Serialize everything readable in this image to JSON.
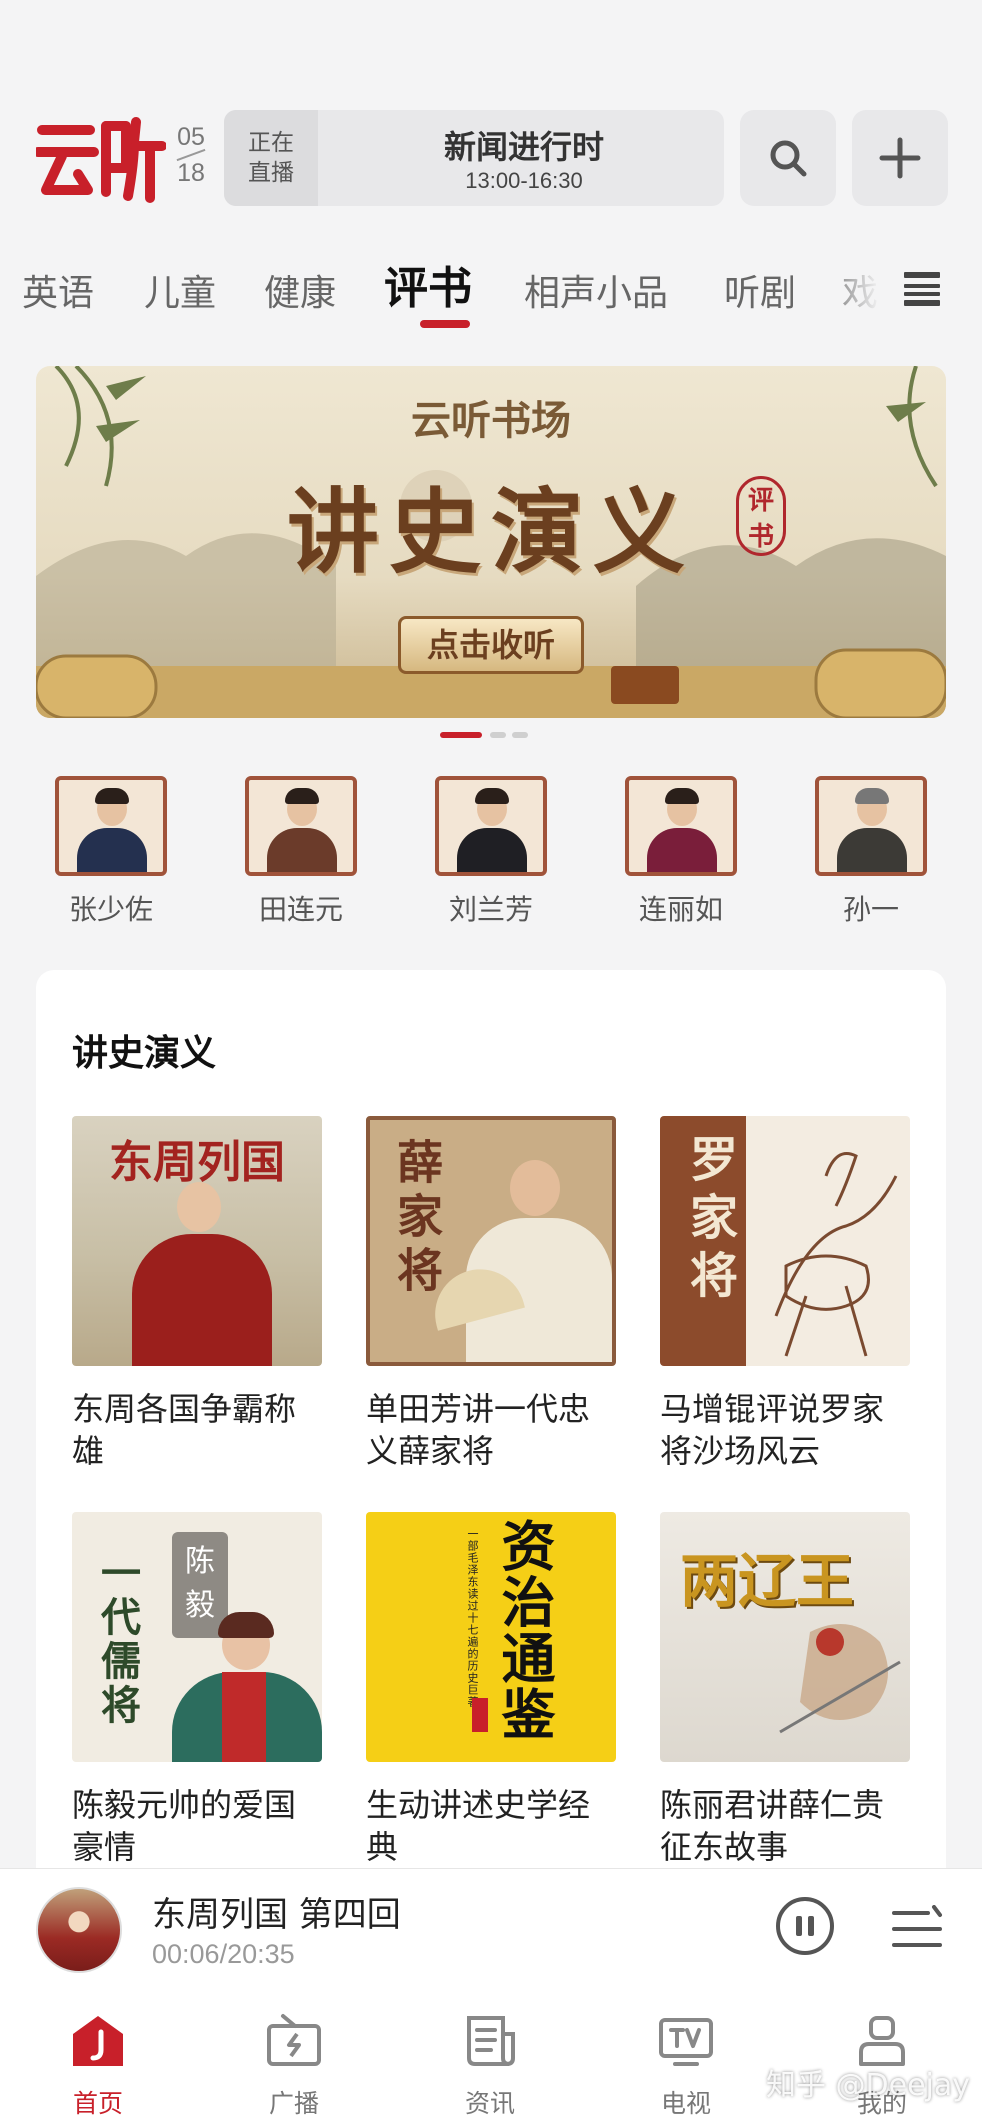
{
  "header": {
    "logo_text": "云听",
    "date_month": "05",
    "date_day": "18",
    "live_tag": "正在直播",
    "live_title": "新闻进行时",
    "live_time": "13:00-16:30"
  },
  "tabs": [
    "英语",
    "儿童",
    "健康",
    "评书",
    "相声小品",
    "听剧",
    "戏"
  ],
  "active_tab": "评书",
  "banner": {
    "subtitle": "云听书场",
    "title": "讲史演义",
    "seal": "评书",
    "cta": "点击收听",
    "slide_index": 1,
    "slide_count": 3
  },
  "hosts": [
    {
      "name": "张少佐"
    },
    {
      "name": "田连元"
    },
    {
      "name": "刘兰芳"
    },
    {
      "name": "连丽如"
    },
    {
      "name": "孙一"
    }
  ],
  "section": {
    "title": "讲史演义",
    "books": [
      {
        "cover_text": "东周列国",
        "caption": "东周各国争霸称雄"
      },
      {
        "cover_text": "薛家将",
        "caption": "单田芳讲一代忠义薛家将"
      },
      {
        "cover_text": "罗家将",
        "caption": "马增锟评说罗家将沙场风云"
      },
      {
        "cover_text": "一代儒将",
        "cover_badge": "陈毅",
        "caption": "陈毅元帅的爱国豪情"
      },
      {
        "cover_text": "资治通鉴",
        "cover_note": "一部毛泽东读过十七遍的历史巨著",
        "caption": "生动讲述史学经典"
      },
      {
        "cover_text": "两辽王",
        "caption": "陈丽君讲薛仁贵征东故事"
      }
    ]
  },
  "player": {
    "title": "东周列国 第四回",
    "time": "00:06/20:35"
  },
  "nav": [
    {
      "label": "首页",
      "icon": "home-icon",
      "active": true
    },
    {
      "label": "广播",
      "icon": "radio-icon",
      "active": false
    },
    {
      "label": "资讯",
      "icon": "news-icon",
      "active": false
    },
    {
      "label": "电视",
      "icon": "tv-icon",
      "active": false
    },
    {
      "label": "我的",
      "icon": "profile-icon",
      "active": false
    }
  ],
  "watermark": "知乎 @Deejay",
  "colors": {
    "accent": "#c8202a",
    "background": "#f4f4f5"
  }
}
